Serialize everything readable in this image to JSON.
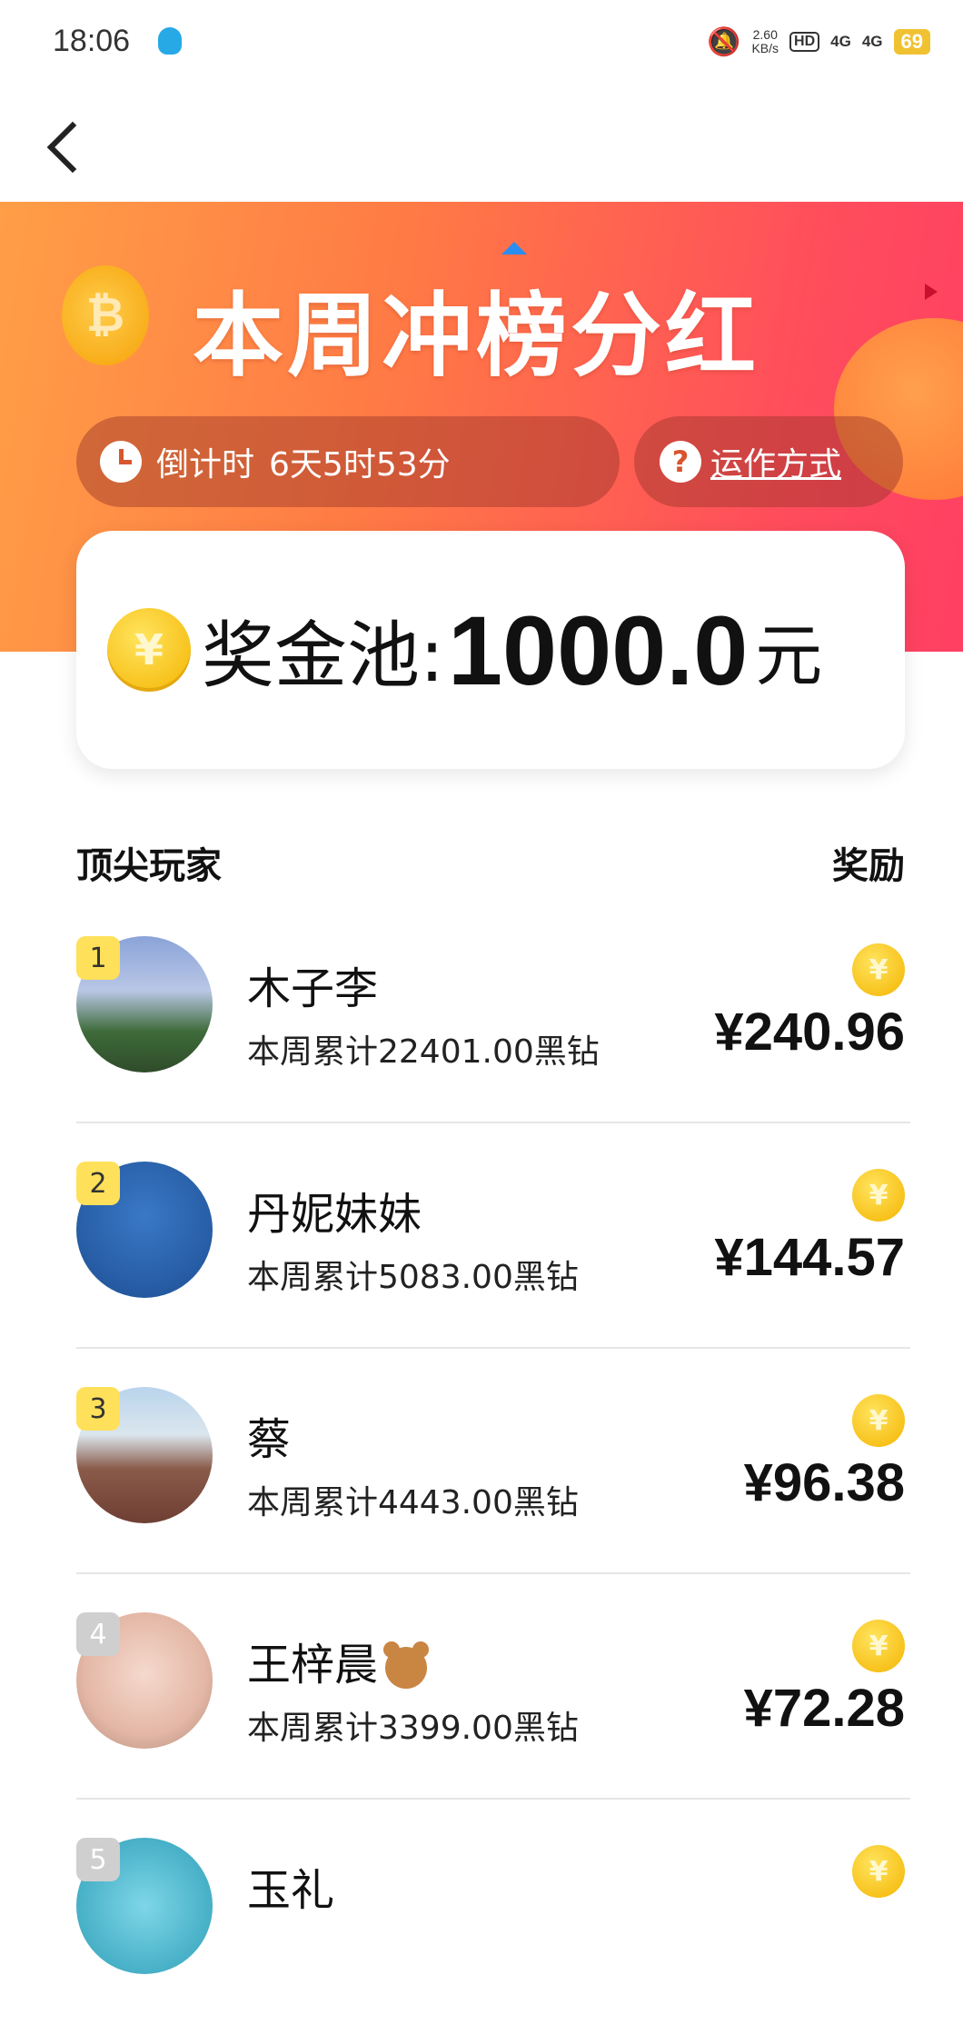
{
  "status_bar": {
    "time": "18:06",
    "net_speed_value": "2.60",
    "net_speed_unit": "KB/s",
    "hd_label": "HD",
    "signal1": "4G",
    "signal2": "4G",
    "battery": "69"
  },
  "banner": {
    "title": "本周冲榜分红",
    "countdown_label": "倒计时",
    "countdown_value": "6天5时53分",
    "how_it_works": "运作方式"
  },
  "prize_pool": {
    "label": "奖金池:",
    "amount": "1000.0",
    "unit": "元"
  },
  "list_header": {
    "left": "顶尖玩家",
    "right": "奖励"
  },
  "players": [
    {
      "rank": "1",
      "name": "木子李",
      "score": "本周累计22401.00黑钻",
      "reward": "¥240.96"
    },
    {
      "rank": "2",
      "name": "丹妮妹妹",
      "score": "本周累计5083.00黑钻",
      "reward": "¥144.57"
    },
    {
      "rank": "3",
      "name": "蔡",
      "score": "本周累计4443.00黑钻",
      "reward": "¥96.38"
    },
    {
      "rank": "4",
      "name": "王梓晨",
      "score": "本周累计3399.00黑钻",
      "reward": "¥72.28"
    },
    {
      "rank": "5",
      "name": "玉礼",
      "score": "",
      "reward": ""
    }
  ],
  "colors": {
    "banner_start": "#ff9e47",
    "banner_end": "#ff3f63",
    "rank_badge": "#ffe05a",
    "coin": "#f4b400"
  }
}
